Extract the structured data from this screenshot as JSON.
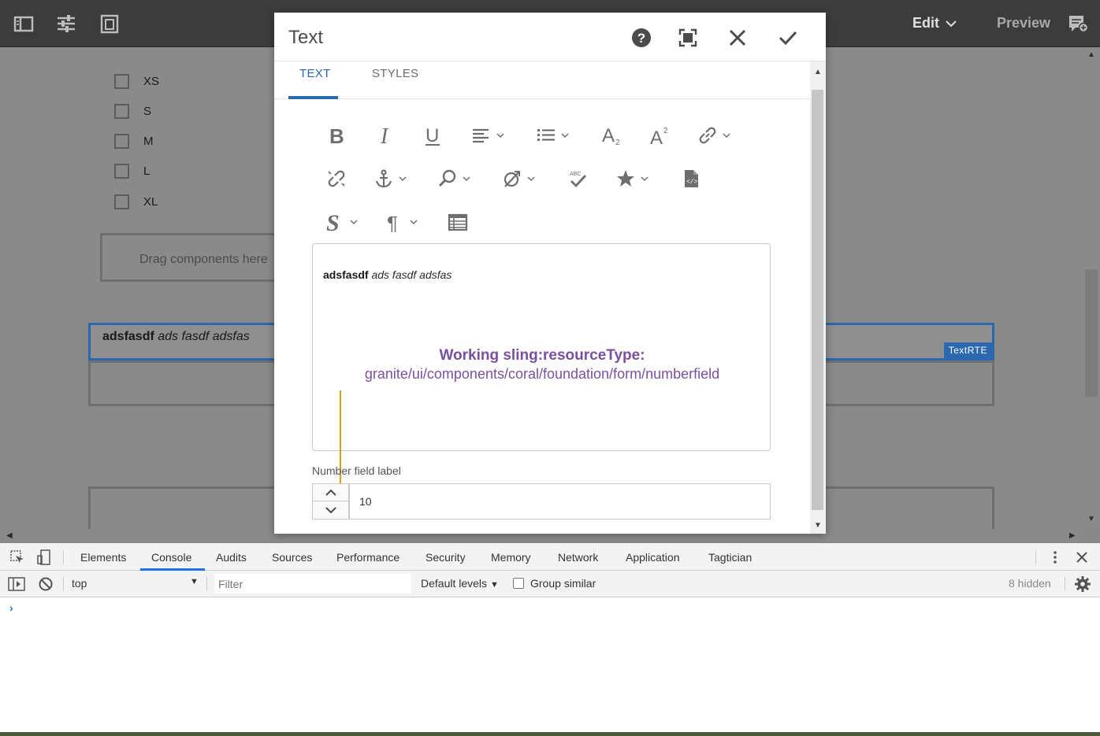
{
  "topbar": {
    "edit_label": "Edit",
    "preview_label": "Preview"
  },
  "page": {
    "size_options": [
      "XS",
      "S",
      "M",
      "L",
      "XL"
    ],
    "drag_placeholder": "Drag components here",
    "text_component": {
      "bold_text": "adsfasdf",
      "italic_text": " ads fasdf adsfas",
      "badge": "TextRTE"
    }
  },
  "dialog": {
    "title": "Text",
    "tabs": [
      "TEXT",
      "STYLES"
    ],
    "active_tab": "TEXT",
    "rte_content": {
      "bold_text": "adsfasdf",
      "italic_text": " ads fasdf adsfas"
    },
    "annotation": {
      "title": "Working sling:resourceType:",
      "path": "granite/ui/components/coral/foundation/form/numberfield",
      "color": "#7b4fa0"
    },
    "number_field": {
      "label": "Number field label",
      "value": "10"
    }
  },
  "devtools": {
    "tabs": [
      "Elements",
      "Console",
      "Audits",
      "Sources",
      "Performance",
      "Security",
      "Memory",
      "Network",
      "Application",
      "Tagtician"
    ],
    "active_tab": "Console",
    "context": "top",
    "filter_placeholder": "Filter",
    "levels_label": "Default levels",
    "group_similar_label": "Group similar",
    "hidden_count": "8 hidden",
    "prompt": "›"
  },
  "colors": {
    "accent": "#2b68b0",
    "devtools_accent": "#1a73e8",
    "annotation_line": "#d4a21a"
  }
}
